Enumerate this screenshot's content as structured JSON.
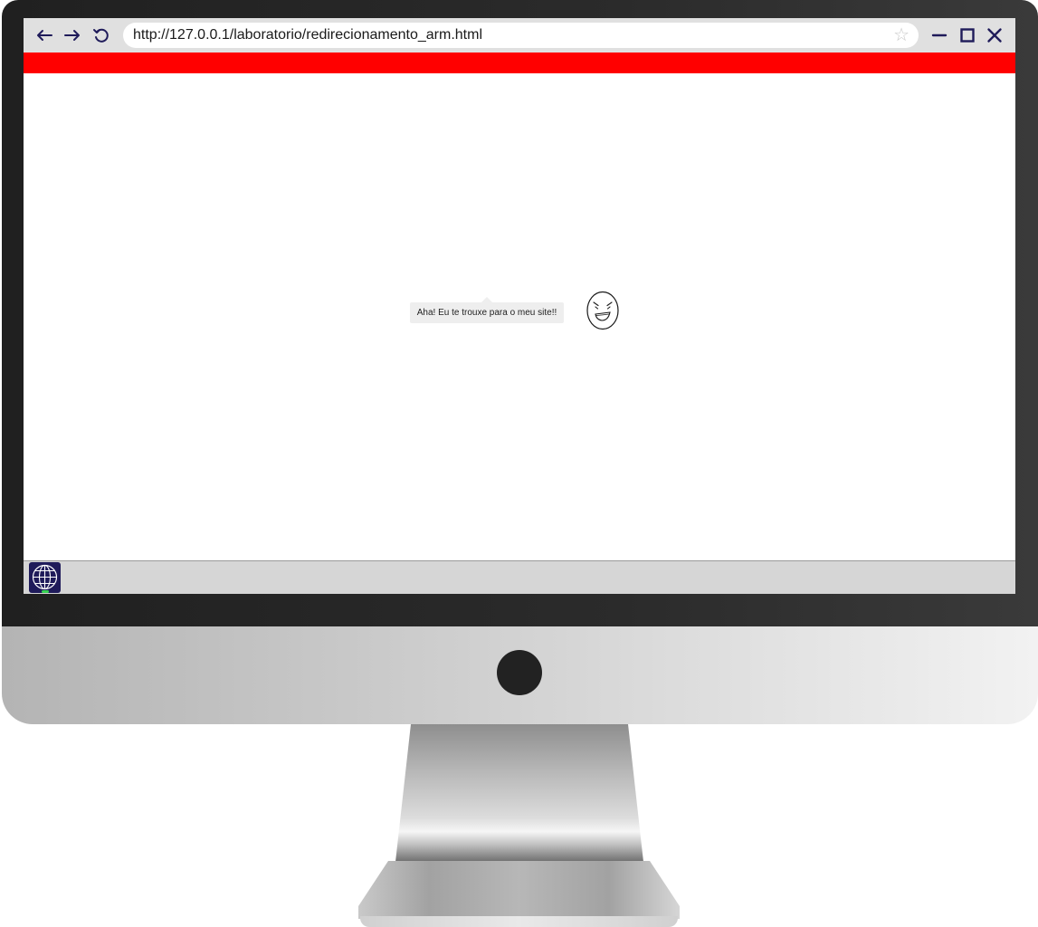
{
  "browser": {
    "url": "http://127.0.0.1/laboratorio/redirecionamento_arm.html",
    "nav": {
      "back_icon": "arrow-left-icon",
      "forward_icon": "arrow-right-icon",
      "reload_icon": "reload-icon"
    },
    "bookmark_icon": "star-icon",
    "window_controls": [
      "minimize-icon",
      "maximize-icon",
      "close-icon"
    ]
  },
  "page": {
    "banner_color": "#ff0000",
    "speech_text": "Aha! Eu te trouxe para o meu site!!",
    "face_icon": "evil-grin-face-icon"
  },
  "taskbar": {
    "items": [
      {
        "icon": "globe-browser-icon",
        "active": true
      }
    ]
  },
  "colors": {
    "icon_color": "#1f1b5a",
    "banner": "#ff0000",
    "taskbar": "#d6d6d6",
    "active_indicator": "#39d353"
  }
}
